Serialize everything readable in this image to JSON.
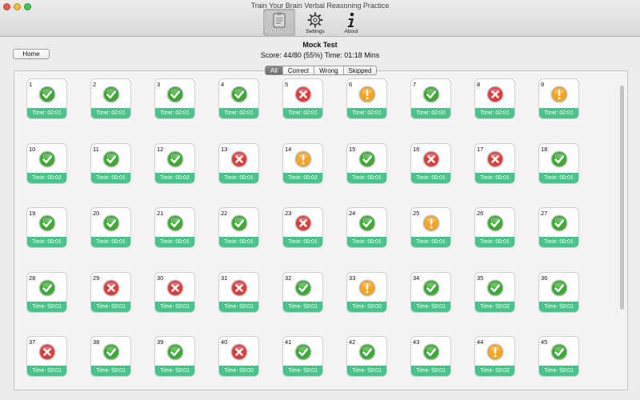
{
  "window": {
    "title": "Train Your Brain Verbal Reasoning Practice"
  },
  "toolbar": {
    "items": [
      {
        "label": "Practice Test",
        "icon": "clipboard-icon",
        "active": true
      },
      {
        "label": "Settings",
        "icon": "gear-icon",
        "active": false
      },
      {
        "label": "About",
        "icon": "info-icon",
        "active": false
      }
    ]
  },
  "header": {
    "home_label": "Home",
    "title": "Mock Test",
    "score_line": "Score: 44/80 (55%) Time: 01:18 Mins"
  },
  "filters": {
    "items": [
      {
        "label": "All",
        "active": true
      },
      {
        "label": "Correct",
        "active": false
      },
      {
        "label": "Wrong",
        "active": false
      },
      {
        "label": "Skipped",
        "active": false
      }
    ]
  },
  "colors": {
    "correct": "#3aa832",
    "wrong": "#e23a3a",
    "skipped": "#f2a51e",
    "time_bar": "#4ac38a"
  },
  "questions": [
    {
      "num": "1",
      "status": "correct",
      "time": "Time: 00:01"
    },
    {
      "num": "2",
      "status": "correct",
      "time": "Time: 00:01"
    },
    {
      "num": "3",
      "status": "correct",
      "time": "Time: 00:01"
    },
    {
      "num": "4",
      "status": "correct",
      "time": "Time: 00:01"
    },
    {
      "num": "5",
      "status": "wrong",
      "time": "Time: 00:01"
    },
    {
      "num": "6",
      "status": "skipped",
      "time": "Time: 00:01"
    },
    {
      "num": "7",
      "status": "correct",
      "time": "Time: 00:00"
    },
    {
      "num": "8",
      "status": "wrong",
      "time": "Time: 00:01"
    },
    {
      "num": "9",
      "status": "skipped",
      "time": "Time: 00:01"
    },
    {
      "num": "10",
      "status": "correct",
      "time": "Time: 00:02"
    },
    {
      "num": "11",
      "status": "correct",
      "time": "Time: 00:01"
    },
    {
      "num": "12",
      "status": "correct",
      "time": "Time: 00:02"
    },
    {
      "num": "13",
      "status": "wrong",
      "time": "Time: 00:01"
    },
    {
      "num": "14",
      "status": "skipped",
      "time": "Time: 00:02"
    },
    {
      "num": "15",
      "status": "correct",
      "time": "Time: 00:01"
    },
    {
      "num": "16",
      "status": "wrong",
      "time": "Time: 00:01"
    },
    {
      "num": "17",
      "status": "wrong",
      "time": "Time: 00:01"
    },
    {
      "num": "18",
      "status": "correct",
      "time": "Time: 00:01"
    },
    {
      "num": "19",
      "status": "correct",
      "time": "Time: 00:01"
    },
    {
      "num": "20",
      "status": "correct",
      "time": "Time: 00:01"
    },
    {
      "num": "21",
      "status": "correct",
      "time": "Time: 00:01"
    },
    {
      "num": "22",
      "status": "correct",
      "time": "Time: 00:01"
    },
    {
      "num": "23",
      "status": "wrong",
      "time": "Time: 00:01"
    },
    {
      "num": "24",
      "status": "correct",
      "time": "Time: 00:01"
    },
    {
      "num": "25",
      "status": "skipped",
      "time": "Time: 00:01"
    },
    {
      "num": "26",
      "status": "correct",
      "time": "Time: 00:01"
    },
    {
      "num": "27",
      "status": "correct",
      "time": "Time: 00:01"
    },
    {
      "num": "28",
      "status": "correct",
      "time": "Time: 00:01"
    },
    {
      "num": "29",
      "status": "wrong",
      "time": "Time: 00:01"
    },
    {
      "num": "30",
      "status": "wrong",
      "time": "Time: 00:01"
    },
    {
      "num": "31",
      "status": "wrong",
      "time": "Time: 00:01"
    },
    {
      "num": "32",
      "status": "correct",
      "time": "Time: 00:01"
    },
    {
      "num": "33",
      "status": "skipped",
      "time": "Time: 00:00"
    },
    {
      "num": "34",
      "status": "correct",
      "time": "Time: 00:01"
    },
    {
      "num": "35",
      "status": "correct",
      "time": "Time: 00:02"
    },
    {
      "num": "36",
      "status": "correct",
      "time": "Time: 00:01"
    },
    {
      "num": "37",
      "status": "wrong",
      "time": "Time: 00:01"
    },
    {
      "num": "38",
      "status": "correct",
      "time": "Time: 00:01"
    },
    {
      "num": "39",
      "status": "correct",
      "time": "Time: 00:01"
    },
    {
      "num": "40",
      "status": "wrong",
      "time": "Time: 00:00"
    },
    {
      "num": "41",
      "status": "correct",
      "time": "Time: 00:01"
    },
    {
      "num": "42",
      "status": "correct",
      "time": "Time: 00:01"
    },
    {
      "num": "43",
      "status": "correct",
      "time": "Time: 00:01"
    },
    {
      "num": "44",
      "status": "skipped",
      "time": "Time: 00:02"
    },
    {
      "num": "45",
      "status": "correct",
      "time": "Time: 00:01"
    }
  ]
}
